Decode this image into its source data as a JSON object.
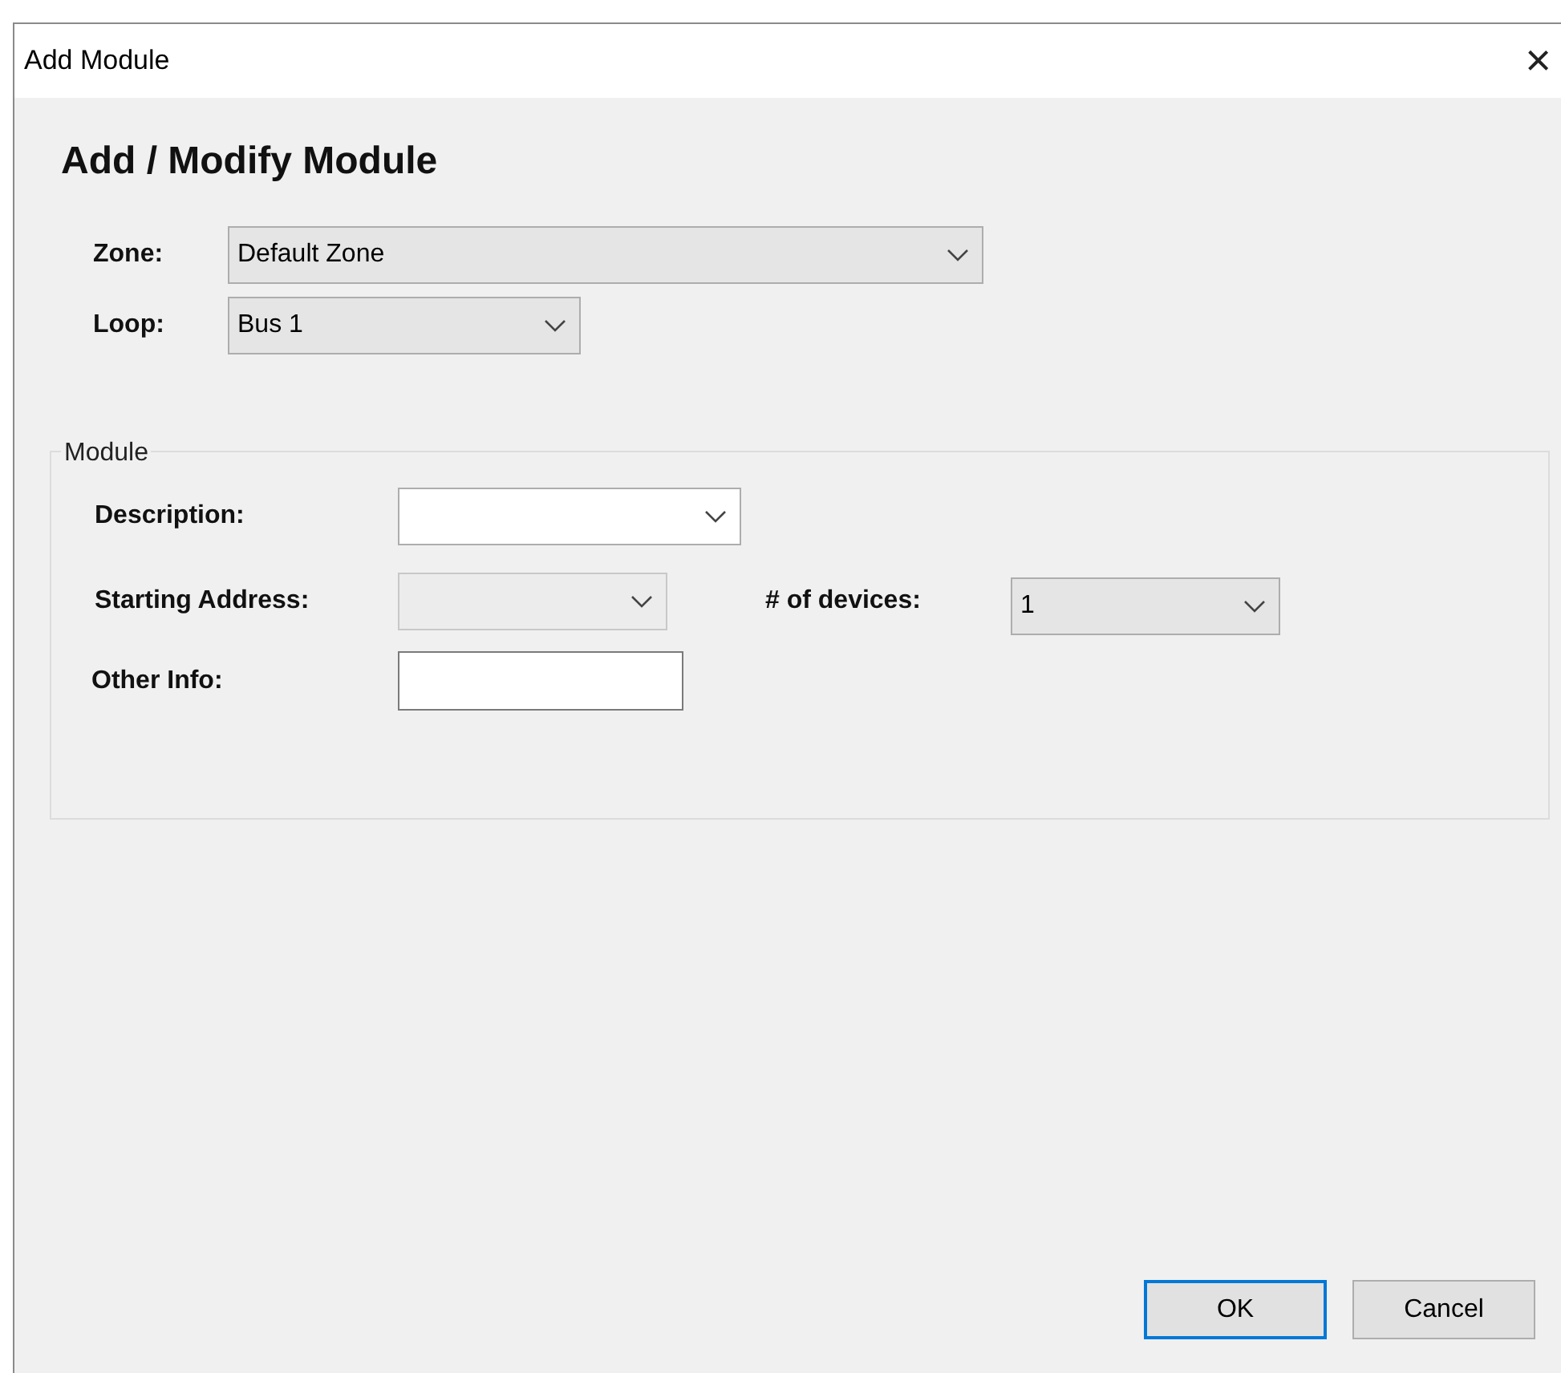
{
  "window": {
    "title": "Add Module",
    "close": "×"
  },
  "heading": "Add / Modify Module",
  "top_fields": [
    {
      "label": "Zone:",
      "value": "Default Zone",
      "disabled": false
    },
    {
      "label": "Loop:",
      "value": "Bus 1",
      "disabled": false
    }
  ],
  "group": {
    "title": "Module",
    "description": {
      "label": "Description:",
      "disabled": false
    },
    "starting_address": {
      "label": "Starting Address:",
      "disabled": true
    },
    "devices": {
      "label": "# of devices:",
      "value": "1",
      "disabled": false
    },
    "other_info": {
      "label": "Other Info:"
    }
  },
  "buttons": [
    {
      "label": "OK",
      "default": true
    },
    {
      "label": "Cancel",
      "default": false
    }
  ]
}
